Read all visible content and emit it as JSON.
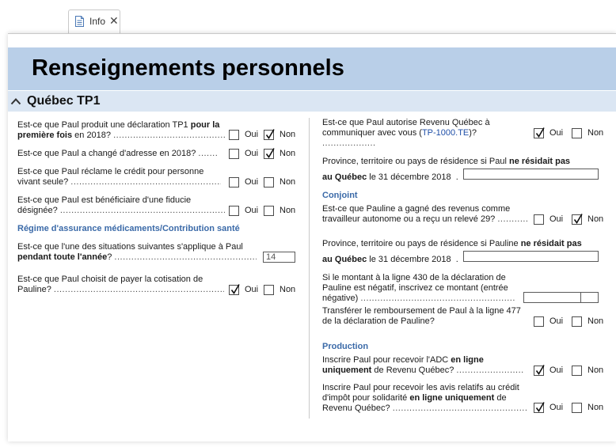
{
  "tab": {
    "label": "Info",
    "close": "✕"
  },
  "page_title": "Renseignements personnels",
  "section_title": "Québec TP1",
  "common": {
    "oui": "Oui",
    "non": "Non"
  },
  "left": {
    "q1": {
      "pre": "Est-ce que Paul produit une déclaration TP1 ",
      "bold1": "pour la",
      "bold2": "première fois",
      "post": " en 2018?",
      "oui": false,
      "non": true
    },
    "q2": {
      "text": "Est-ce que Paul a changé d'adresse en 2018?",
      "oui": false,
      "non": true
    },
    "q3": {
      "line1": "Est-ce que Paul réclame le crédit pour personne",
      "line2": "vivant seule?",
      "oui": false,
      "non": false
    },
    "q4": {
      "line1": "Est-ce que Paul est bénéficiaire d'une fiducie",
      "line2": "désignée?",
      "oui": false,
      "non": false
    },
    "subhead": "Régime d'assurance médicaments/Contribution santé",
    "q5": {
      "line1": "Est-ce que l'une des situations suivantes s'applique à Paul",
      "bold": "pendant toute l'année",
      "post": "?",
      "value": "14"
    },
    "q6": {
      "line1": "Est-ce que Paul choisit de payer la cotisation de",
      "line2": "Pauline?",
      "oui": true,
      "non": false
    }
  },
  "right": {
    "q1": {
      "line1": "Est-ce que Paul autorise Revenu Québec à",
      "pre2": "communiquer avec vous (",
      "link": "TP-1000.TE",
      "post2": ")?",
      "oui": true,
      "non": false
    },
    "q2": {
      "pre": "Province, territoire ou pays de résidence si Paul ",
      "bold1": "ne résidait pas",
      "bold2": "au Québec",
      "post": " le 31 décembre 2018",
      "dot": ".",
      "value": ""
    },
    "conjoint": "Conjoint",
    "q3": {
      "line1": "Est-ce que Pauline a gagné des revenus comme",
      "line2": "travailleur autonome ou a reçu un relevé 29?",
      "oui": false,
      "non": true
    },
    "q4": {
      "pre": "Province, territoire ou pays de résidence si Pauline ",
      "bold1": "ne résidait pas",
      "bold2": "au Québec",
      "post": " le 31 décembre 2018",
      "dot": ".",
      "value": ""
    },
    "q5": {
      "line1": "Si le montant à la ligne 430 de la déclaration de",
      "line2": "Pauline est négatif, inscrivez ce montant (entrée",
      "line3": "négative)",
      "value": ""
    },
    "q6": {
      "line1": "Transférer le remboursement de Paul à la ligne 477",
      "line2": "de la déclaration de Pauline?",
      "oui": false,
      "non": false
    },
    "production": "Production",
    "q7": {
      "pre": "Inscrire Paul pour recevoir l'ADC ",
      "bold1": "en ligne",
      "bold2": "uniquement",
      "post": " de Revenu Québec?",
      "oui": true,
      "non": false
    },
    "q8": {
      "line1": "Inscrire Paul pour recevoir les avis relatifs au crédit",
      "pre2": "d'impôt pour solidarité ",
      "bold2": "en ligne uniquement",
      "post2": " de",
      "line3": "Revenu Québec?",
      "oui": true,
      "non": false
    }
  }
}
